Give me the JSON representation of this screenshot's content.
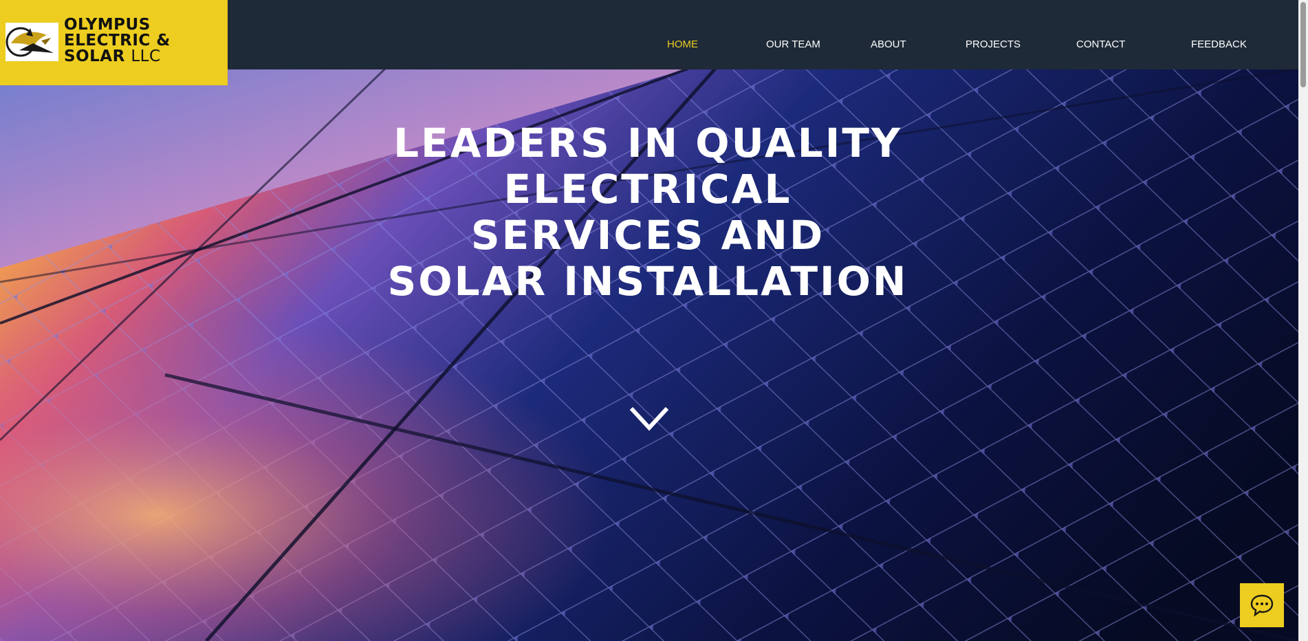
{
  "brand": {
    "line1": "OLYMPUS",
    "line2": "ELECTRIC &",
    "line3_bold": "SOLAR",
    "line3_light": "LLC",
    "emblem_icon": "olympus-emblem-icon"
  },
  "nav": {
    "items": [
      {
        "label": "HOME",
        "active": true
      },
      {
        "label": "OUR TEAM",
        "active": false
      },
      {
        "label": "ABOUT",
        "active": false
      },
      {
        "label": "PROJECTS",
        "active": false
      },
      {
        "label": "CONTACT",
        "active": false
      },
      {
        "label": "FEEDBACK",
        "active": false
      }
    ]
  },
  "hero": {
    "headline_lines": [
      "LEADERS IN QUALITY",
      "ELECTRICAL",
      "SERVICES AND",
      "SOLAR INSTALLATION"
    ],
    "scroll_icon": "chevron-down-icon"
  },
  "chat": {
    "icon": "chat-bubble-icon"
  },
  "colors": {
    "accent": "#edcd1f",
    "navbar": "#1e2a38",
    "text_light": "#ffffff"
  }
}
